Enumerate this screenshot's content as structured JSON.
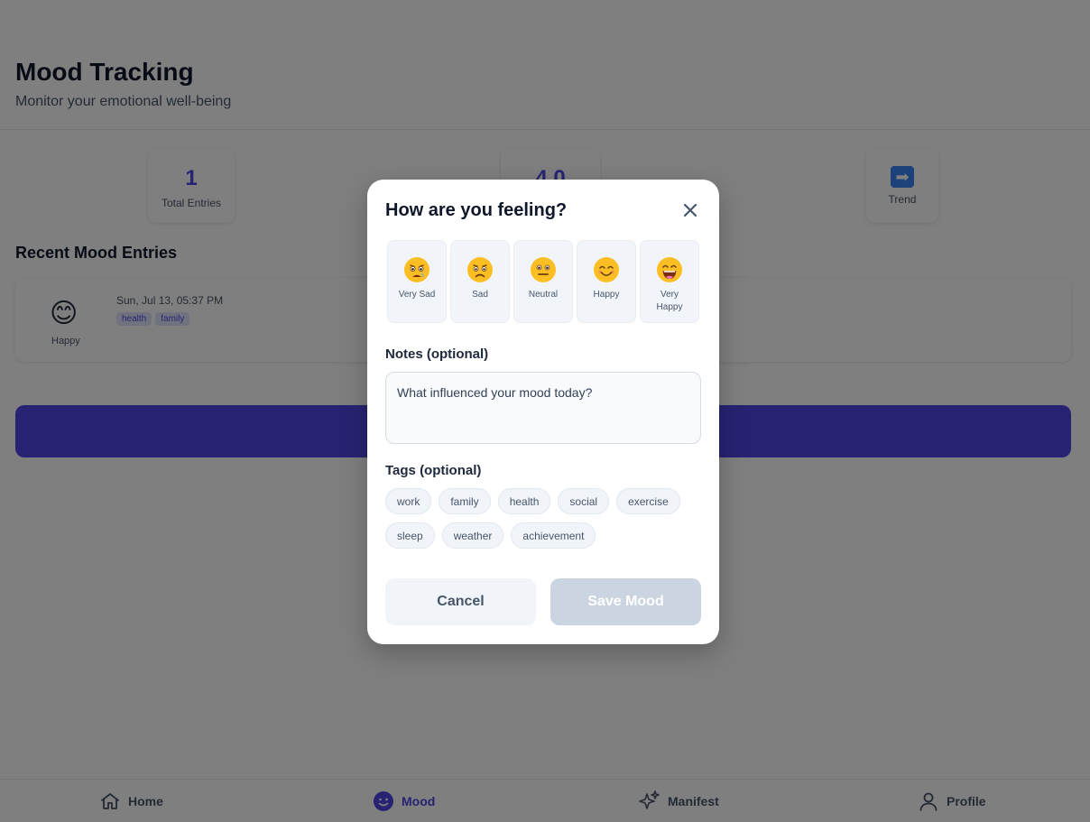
{
  "header": {
    "title": "Mood Tracking",
    "subtitle": "Monitor your emotional well-being"
  },
  "stats": [
    {
      "value": "1",
      "label": "Total Entries"
    },
    {
      "value": "4.0",
      "label": ""
    },
    {
      "icon": "right-arrow-icon",
      "label": "Trend"
    }
  ],
  "recent": {
    "title": "Recent Mood Entries",
    "entries": [
      {
        "emoji": "😊",
        "mood": "Happy",
        "date": "Sun, Jul 13, 05:37 PM",
        "tags": [
          "health",
          "family"
        ]
      }
    ]
  },
  "nav": {
    "items": [
      {
        "label": "Home",
        "icon": "home-icon",
        "active": false
      },
      {
        "label": "Mood",
        "icon": "smiley-icon",
        "active": true
      },
      {
        "label": "Manifest",
        "icon": "sparkles-icon",
        "active": false
      },
      {
        "label": "Profile",
        "icon": "user-icon",
        "active": false
      }
    ]
  },
  "modal": {
    "title": "How are you feeling?",
    "moods": [
      {
        "label": "Very Sad",
        "icon": "very-sad-face-icon"
      },
      {
        "label": "Sad",
        "icon": "sad-face-icon"
      },
      {
        "label": "Neutral",
        "icon": "neutral-face-icon"
      },
      {
        "label": "Happy",
        "icon": "happy-face-icon"
      },
      {
        "label": "Very Happy",
        "icon": "very-happy-face-icon"
      }
    ],
    "notes_label": "Notes (optional)",
    "notes_placeholder": "What influenced your mood today?",
    "notes_value": "",
    "tags_label": "Tags (optional)",
    "tags": [
      "work",
      "family",
      "health",
      "social",
      "exercise",
      "sleep",
      "weather",
      "achievement"
    ],
    "cancel_label": "Cancel",
    "save_label": "Save Mood"
  },
  "colors": {
    "accent": "#4f46e5",
    "overlay": "rgba(0,0,0,0.5)",
    "save_disabled": "#cbd5e1"
  }
}
